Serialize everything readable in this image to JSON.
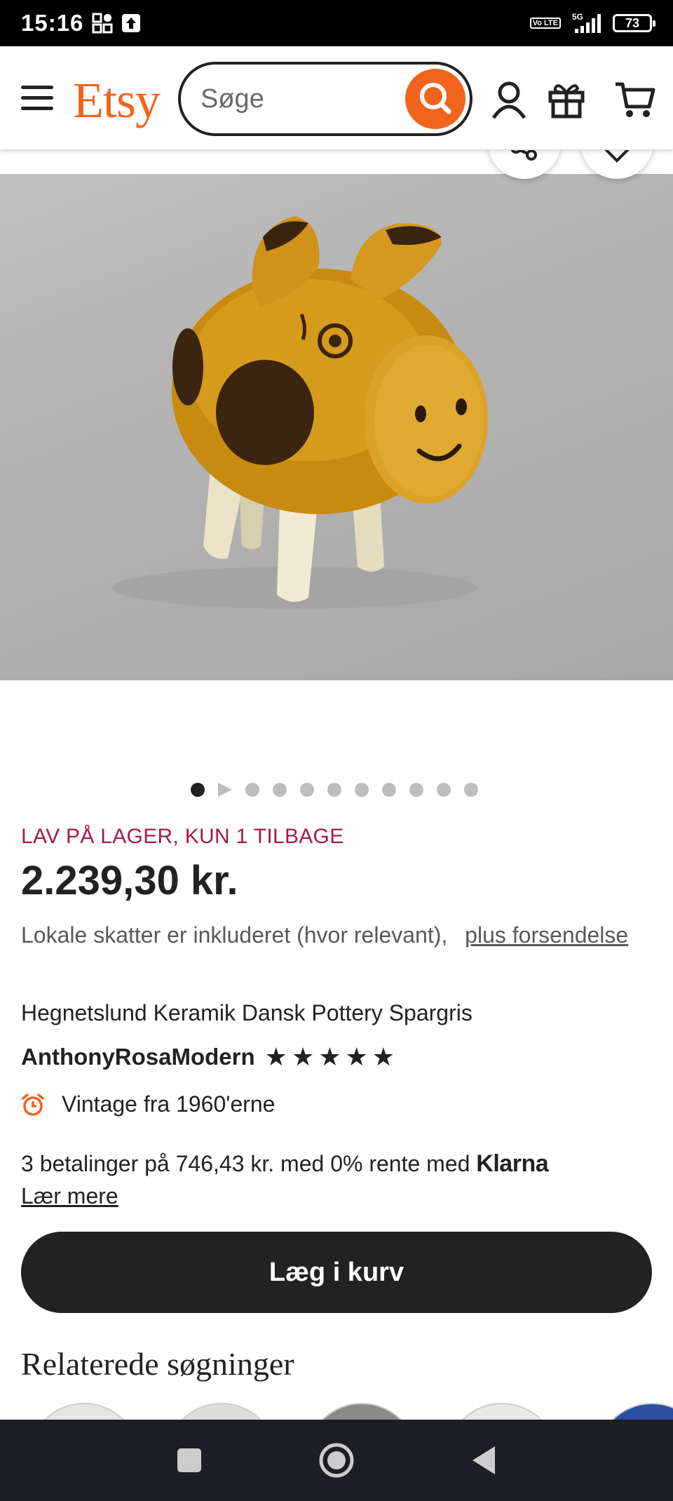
{
  "status_bar": {
    "time": "15:16",
    "network": "5G",
    "volte": "Vo LTE",
    "battery": "73"
  },
  "header": {
    "logo": "Etsy",
    "search_placeholder": "Søge"
  },
  "carousel": {
    "image_alt": "Hegnetslund Keramik Dansk Pottery Spargris",
    "dot_count": 11,
    "active_index": 0
  },
  "product": {
    "stock_notice": "LAV PÅ LAGER, KUN 1 TILBAGE",
    "price": "2.239,30 kr.",
    "tax_text": "Lokale skatter er inkluderet (hvor relevant),",
    "shipping_link": "plus forsendelse",
    "title": "Hegnetslund Keramik Dansk Pottery Spargris",
    "shop_name": "AnthonyRosaModern",
    "rating": 5,
    "vintage": "Vintage fra 1960'erne",
    "installments_text": "3 betalinger på 746,43 kr. med 0% rente med",
    "klarna": "Klarna",
    "learn_more": "Lær mere",
    "add_to_cart": "Læg i kurv"
  },
  "related": {
    "heading": "Relaterede søgninger"
  },
  "colors": {
    "brand": "#f1641e",
    "dark": "#222222",
    "stock": "#a61a4a"
  }
}
